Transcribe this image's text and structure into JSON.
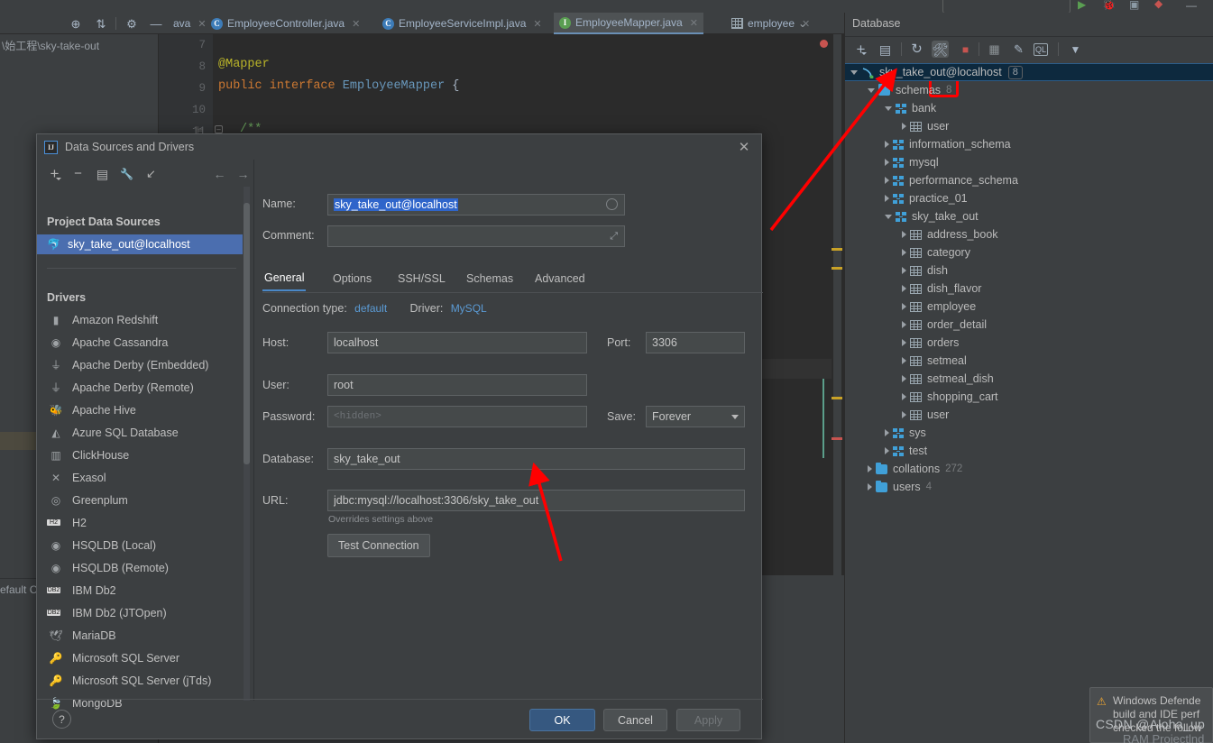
{
  "ide": {
    "project_path": "\\始工程\\sky-take-out",
    "default_c_label": "efault C",
    "tabs": [
      {
        "label": "ava",
        "icon": "",
        "type": "plain",
        "active": false
      },
      {
        "label": "EmployeeController.java",
        "icon": "class-icon",
        "type": "class",
        "active": false
      },
      {
        "label": "EmployeeServiceImpl.java",
        "icon": "class-icon",
        "type": "class",
        "active": false
      },
      {
        "label": "EmployeeMapper.java",
        "icon": "interface-icon",
        "type": "interface",
        "active": true
      },
      {
        "label": "employee",
        "icon": "table-icon",
        "type": "table",
        "active": false
      }
    ],
    "editor": {
      "line_numbers": [
        "7",
        "8",
        "9",
        "10",
        "11"
      ],
      "lines": [
        {
          "num": "7",
          "text": ""
        },
        {
          "num": "8",
          "text": "@Mapper"
        },
        {
          "num": "9",
          "text": "public interface EmployeeMapper {"
        },
        {
          "num": "10",
          "text": ""
        },
        {
          "num": "11",
          "text": "/**"
        }
      ],
      "code_annotation": "@Mapper",
      "code_keyword1": "public",
      "code_keyword2": "interface",
      "code_classname": "EmployeeMapper",
      "code_brace": "{",
      "code_comment": "/**"
    }
  },
  "database_panel": {
    "title": "Database",
    "toolbar": [
      {
        "name": "add-data-source-icon",
        "glyph": "+"
      },
      {
        "name": "duplicate-icon",
        "glyph": "❐"
      },
      {
        "name": "refresh-icon",
        "glyph": "↻"
      },
      {
        "name": "data-source-properties-icon",
        "glyph": "⚙",
        "highlighted": true
      },
      {
        "name": "stop-icon",
        "glyph": "■"
      },
      {
        "name": "open-table-icon",
        "glyph": "▦"
      },
      {
        "name": "modify-icon",
        "glyph": "✎"
      },
      {
        "name": "query-console-icon",
        "glyph": "QL"
      },
      {
        "name": "filter-icon",
        "glyph": "▼"
      }
    ],
    "tree": [
      {
        "label": "sky_take_out@localhost",
        "badge": "8",
        "indent": 0,
        "expanded": true,
        "icon": "connection-icon",
        "selected": true
      },
      {
        "label": "schemas",
        "count": "8",
        "indent": 1,
        "expanded": true,
        "icon": "folder-icon"
      },
      {
        "label": "bank",
        "indent": 2,
        "expanded": true,
        "icon": "schema-icon"
      },
      {
        "label": "user",
        "indent": 3,
        "expanded": false,
        "icon": "table-icon"
      },
      {
        "label": "information_schema",
        "indent": 2,
        "expanded": false,
        "icon": "schema-icon"
      },
      {
        "label": "mysql",
        "indent": 2,
        "expanded": false,
        "icon": "schema-icon"
      },
      {
        "label": "performance_schema",
        "indent": 2,
        "expanded": false,
        "icon": "schema-icon"
      },
      {
        "label": "practice_01",
        "indent": 2,
        "expanded": false,
        "icon": "schema-icon"
      },
      {
        "label": "sky_take_out",
        "indent": 2,
        "expanded": true,
        "icon": "schema-icon"
      },
      {
        "label": "address_book",
        "indent": 3,
        "expanded": false,
        "icon": "table-icon"
      },
      {
        "label": "category",
        "indent": 3,
        "expanded": false,
        "icon": "table-icon"
      },
      {
        "label": "dish",
        "indent": 3,
        "expanded": false,
        "icon": "table-icon"
      },
      {
        "label": "dish_flavor",
        "indent": 3,
        "expanded": false,
        "icon": "table-icon"
      },
      {
        "label": "employee",
        "indent": 3,
        "expanded": false,
        "icon": "table-icon"
      },
      {
        "label": "order_detail",
        "indent": 3,
        "expanded": false,
        "icon": "table-icon"
      },
      {
        "label": "orders",
        "indent": 3,
        "expanded": false,
        "icon": "table-icon"
      },
      {
        "label": "setmeal",
        "indent": 3,
        "expanded": false,
        "icon": "table-icon"
      },
      {
        "label": "setmeal_dish",
        "indent": 3,
        "expanded": false,
        "icon": "table-icon"
      },
      {
        "label": "shopping_cart",
        "indent": 3,
        "expanded": false,
        "icon": "table-icon"
      },
      {
        "label": "user",
        "indent": 3,
        "expanded": false,
        "icon": "table-icon"
      },
      {
        "label": "sys",
        "indent": 2,
        "expanded": false,
        "icon": "schema-icon"
      },
      {
        "label": "test",
        "indent": 2,
        "expanded": false,
        "icon": "schema-icon"
      },
      {
        "label": "collations",
        "count": "272",
        "indent": 1,
        "expanded": false,
        "icon": "folder-icon"
      },
      {
        "label": "users",
        "count": "4",
        "indent": 1,
        "expanded": false,
        "icon": "folder-icon"
      }
    ]
  },
  "dialog": {
    "title": "Data Sources and Drivers",
    "close_label": "✕",
    "toolbar": [
      {
        "name": "add-icon",
        "glyph": "+"
      },
      {
        "name": "remove-icon",
        "glyph": "−"
      },
      {
        "name": "copy-icon",
        "glyph": "❐"
      },
      {
        "name": "wrench-icon",
        "glyph": "🔧"
      },
      {
        "name": "import-icon",
        "glyph": "↙"
      },
      {
        "name": "back-arrow-icon",
        "glyph": "←"
      },
      {
        "name": "forward-arrow-icon",
        "glyph": "→"
      }
    ],
    "project_sources_header": "Project Data Sources",
    "data_sources": [
      {
        "label": "sky_take_out@localhost",
        "selected": true
      }
    ],
    "drivers_header": "Drivers",
    "drivers": [
      "Amazon Redshift",
      "Apache Cassandra",
      "Apache Derby (Embedded)",
      "Apache Derby (Remote)",
      "Apache Hive",
      "Azure SQL Database",
      "ClickHouse",
      "Exasol",
      "Greenplum",
      "H2",
      "HSQLDB (Local)",
      "HSQLDB (Remote)",
      "IBM Db2",
      "IBM Db2 (JTOpen)",
      "MariaDB",
      "Microsoft SQL Server",
      "Microsoft SQL Server (jTds)",
      "MongoDB"
    ],
    "form": {
      "name_label": "Name:",
      "name_value": "sky_take_out@localhost",
      "comment_label": "Comment:",
      "comment_value": "",
      "tabs": [
        {
          "label": "General",
          "active": true
        },
        {
          "label": "Options",
          "active": false
        },
        {
          "label": "SSH/SSL",
          "active": false
        },
        {
          "label": "Schemas",
          "active": false
        },
        {
          "label": "Advanced",
          "active": false
        }
      ],
      "connection_type_label": "Connection type:",
      "connection_type_value": "default",
      "driver_label": "Driver:",
      "driver_value": "MySQL",
      "host_label": "Host:",
      "host_value": "localhost",
      "port_label": "Port:",
      "port_value": "3306",
      "user_label": "User:",
      "user_value": "root",
      "password_label": "Password:",
      "password_placeholder": "<hidden>",
      "save_label": "Save:",
      "save_value": "Forever",
      "database_label": "Database:",
      "database_value": "sky_take_out",
      "url_label": "URL:",
      "url_value": "jdbc:mysql://localhost:3306/sky_take_out",
      "url_hint": "Overrides settings above",
      "test_connection_label": "Test Connection"
    },
    "footer": {
      "help_label": "?",
      "ok_label": "OK",
      "cancel_label": "Cancel",
      "apply_label": "Apply"
    }
  },
  "notification": {
    "icon": "warning-icon",
    "line1": "Windows Defende",
    "line2": "build and IDE perf",
    "line3": "checked the follow"
  },
  "watermark": {
    "text": "CSDN @Aloha_up",
    "text2": "RAM Projectlnd"
  },
  "colors": {
    "accent": "#4b6eaf",
    "primary_button": "#365880",
    "highlight_red": "#ff0000",
    "link": "#5b9bd5",
    "tree_selected": "#0d293e"
  }
}
